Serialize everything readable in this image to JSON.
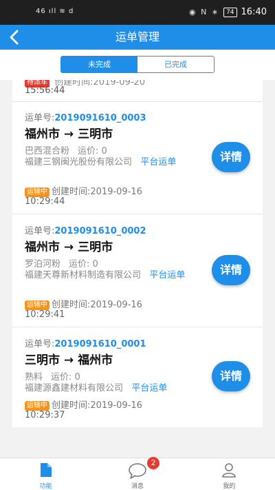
{
  "status_bar": {
    "left": "46 ıll ≋ d",
    "icons": "◉ N ∗",
    "battery": "74",
    "time": "16:40"
  },
  "header": {
    "title": "运单管理"
  },
  "tabs": [
    {
      "label": "未完成"
    },
    {
      "label": "已完成"
    }
  ],
  "partial_card": {
    "status": "待派车",
    "created": "创建时间:2019-09-20",
    "time": "15:56:44"
  },
  "cards": [
    {
      "waybill_label": "运单号:",
      "waybill_no": "2019091610_0003",
      "route": "福州市 → 三明市",
      "goods": "巴西混合粉",
      "price": "运价: 0",
      "company": "福建三钢闽光股份有限公司",
      "platform": "平台运单",
      "status": "运输中",
      "created": "创建时间:2019-09-16",
      "time": "10:29:44",
      "detail": "详情"
    },
    {
      "waybill_label": "运单号:",
      "waybill_no": "2019091610_0002",
      "route": "福州市 → 三明市",
      "goods": "罗泊河粉",
      "price": "运价: 0",
      "company": "福建天尊新材料制造有限公司",
      "platform": "平台运单",
      "status": "运输中",
      "created": "创建时间:2019-09-16",
      "time": "10:29:41",
      "detail": "详情"
    },
    {
      "waybill_label": "运单号:",
      "waybill_no": "2019091610_0001",
      "route": "三明市 → 福州市",
      "goods": "熟料",
      "price": "运价: 0",
      "company": "福建源鑫建材料有限公司",
      "platform": "平台运单",
      "status": "运输中",
      "created": "创建时间:2019-09-16",
      "time": "10:29:37",
      "detail": "详情"
    }
  ],
  "bottom_nav": [
    {
      "label": "功能",
      "icon": "document-icon"
    },
    {
      "label": "消息",
      "icon": "chat-icon",
      "badge": "2"
    },
    {
      "label": "我的",
      "icon": "user-icon"
    }
  ],
  "colors": {
    "primary": "#1f8ee8",
    "status_orange": "#f5931f",
    "status_red": "#e83a2f"
  }
}
